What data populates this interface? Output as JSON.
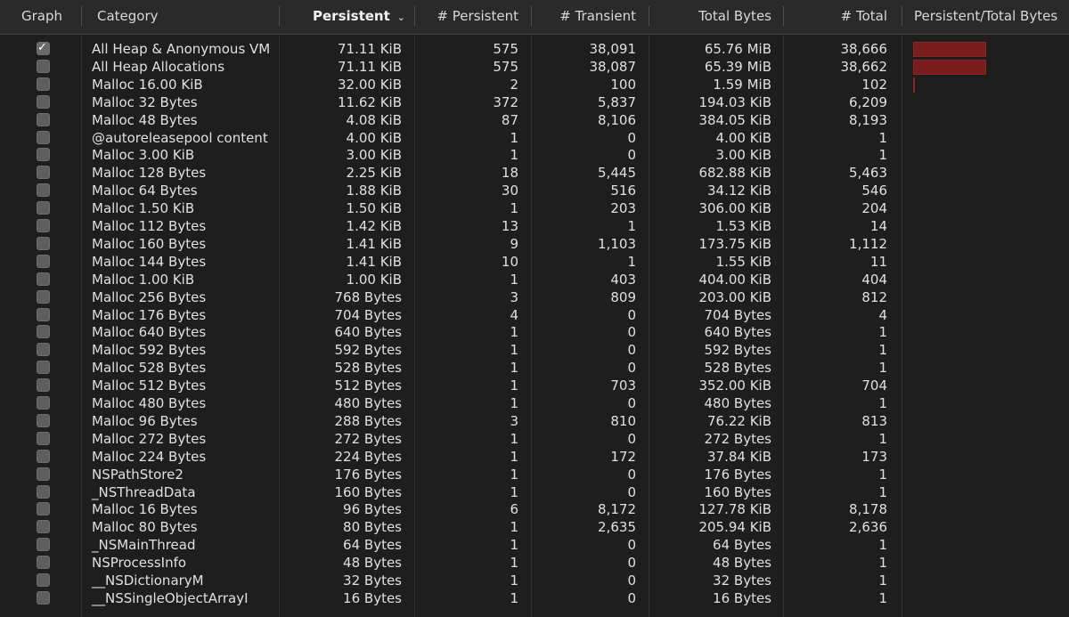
{
  "header": {
    "graph": "Graph",
    "category": "Category",
    "persistent": "Persistent",
    "persistent_count": "# Persistent",
    "transient_count": "# Transient",
    "total_bytes": "Total Bytes",
    "total_count": "# Total",
    "ratio": "Persistent/Total Bytes"
  },
  "sort": {
    "column": "Persistent",
    "direction": "descending",
    "icon": "chevron-down-icon"
  },
  "colors": {
    "ratio_bar": "#7a1d1d"
  },
  "rows": [
    {
      "graph": true,
      "category": "All Heap & Anonymous VM",
      "persistent": "71.11 KiB",
      "persistent_count": "575",
      "transient_count": "38,091",
      "total_bytes": "65.76 MiB",
      "total_count": "38,666",
      "ratio": 1.0
    },
    {
      "graph": false,
      "category": "All Heap Allocations",
      "persistent": "71.11 KiB",
      "persistent_count": "575",
      "transient_count": "38,087",
      "total_bytes": "65.39 MiB",
      "total_count": "38,662",
      "ratio": 1.0
    },
    {
      "graph": false,
      "category": "Malloc 16.00 KiB",
      "persistent": "32.00 KiB",
      "persistent_count": "2",
      "transient_count": "100",
      "total_bytes": "1.59 MiB",
      "total_count": "102",
      "ratio": 0.02
    },
    {
      "graph": false,
      "category": "Malloc 32 Bytes",
      "persistent": "11.62 KiB",
      "persistent_count": "372",
      "transient_count": "5,837",
      "total_bytes": "194.03 KiB",
      "total_count": "6,209",
      "ratio": 0
    },
    {
      "graph": false,
      "category": "Malloc 48 Bytes",
      "persistent": "4.08 KiB",
      "persistent_count": "87",
      "transient_count": "8,106",
      "total_bytes": "384.05 KiB",
      "total_count": "8,193",
      "ratio": 0
    },
    {
      "graph": false,
      "category": "@autoreleasepool content",
      "persistent": "4.00 KiB",
      "persistent_count": "1",
      "transient_count": "0",
      "total_bytes": "4.00 KiB",
      "total_count": "1",
      "ratio": 0
    },
    {
      "graph": false,
      "category": "Malloc 3.00 KiB",
      "persistent": "3.00 KiB",
      "persistent_count": "1",
      "transient_count": "0",
      "total_bytes": "3.00 KiB",
      "total_count": "1",
      "ratio": 0
    },
    {
      "graph": false,
      "category": "Malloc 128 Bytes",
      "persistent": "2.25 KiB",
      "persistent_count": "18",
      "transient_count": "5,445",
      "total_bytes": "682.88 KiB",
      "total_count": "5,463",
      "ratio": 0
    },
    {
      "graph": false,
      "category": "Malloc 64 Bytes",
      "persistent": "1.88 KiB",
      "persistent_count": "30",
      "transient_count": "516",
      "total_bytes": "34.12 KiB",
      "total_count": "546",
      "ratio": 0
    },
    {
      "graph": false,
      "category": "Malloc 1.50 KiB",
      "persistent": "1.50 KiB",
      "persistent_count": "1",
      "transient_count": "203",
      "total_bytes": "306.00 KiB",
      "total_count": "204",
      "ratio": 0
    },
    {
      "graph": false,
      "category": "Malloc 112 Bytes",
      "persistent": "1.42 KiB",
      "persistent_count": "13",
      "transient_count": "1",
      "total_bytes": "1.53 KiB",
      "total_count": "14",
      "ratio": 0
    },
    {
      "graph": false,
      "category": "Malloc 160 Bytes",
      "persistent": "1.41 KiB",
      "persistent_count": "9",
      "transient_count": "1,103",
      "total_bytes": "173.75 KiB",
      "total_count": "1,112",
      "ratio": 0
    },
    {
      "graph": false,
      "category": "Malloc 144 Bytes",
      "persistent": "1.41 KiB",
      "persistent_count": "10",
      "transient_count": "1",
      "total_bytes": "1.55 KiB",
      "total_count": "11",
      "ratio": 0
    },
    {
      "graph": false,
      "category": "Malloc 1.00 KiB",
      "persistent": "1.00 KiB",
      "persistent_count": "1",
      "transient_count": "403",
      "total_bytes": "404.00 KiB",
      "total_count": "404",
      "ratio": 0
    },
    {
      "graph": false,
      "category": "Malloc 256 Bytes",
      "persistent": "768 Bytes",
      "persistent_count": "3",
      "transient_count": "809",
      "total_bytes": "203.00 KiB",
      "total_count": "812",
      "ratio": 0
    },
    {
      "graph": false,
      "category": "Malloc 176 Bytes",
      "persistent": "704 Bytes",
      "persistent_count": "4",
      "transient_count": "0",
      "total_bytes": "704 Bytes",
      "total_count": "4",
      "ratio": 0
    },
    {
      "graph": false,
      "category": "Malloc 640 Bytes",
      "persistent": "640 Bytes",
      "persistent_count": "1",
      "transient_count": "0",
      "total_bytes": "640 Bytes",
      "total_count": "1",
      "ratio": 0
    },
    {
      "graph": false,
      "category": "Malloc 592 Bytes",
      "persistent": "592 Bytes",
      "persistent_count": "1",
      "transient_count": "0",
      "total_bytes": "592 Bytes",
      "total_count": "1",
      "ratio": 0
    },
    {
      "graph": false,
      "category": "Malloc 528 Bytes",
      "persistent": "528 Bytes",
      "persistent_count": "1",
      "transient_count": "0",
      "total_bytes": "528 Bytes",
      "total_count": "1",
      "ratio": 0
    },
    {
      "graph": false,
      "category": "Malloc 512 Bytes",
      "persistent": "512 Bytes",
      "persistent_count": "1",
      "transient_count": "703",
      "total_bytes": "352.00 KiB",
      "total_count": "704",
      "ratio": 0
    },
    {
      "graph": false,
      "category": "Malloc 480 Bytes",
      "persistent": "480 Bytes",
      "persistent_count": "1",
      "transient_count": "0",
      "total_bytes": "480 Bytes",
      "total_count": "1",
      "ratio": 0
    },
    {
      "graph": false,
      "category": "Malloc 96 Bytes",
      "persistent": "288 Bytes",
      "persistent_count": "3",
      "transient_count": "810",
      "total_bytes": "76.22 KiB",
      "total_count": "813",
      "ratio": 0
    },
    {
      "graph": false,
      "category": "Malloc 272 Bytes",
      "persistent": "272 Bytes",
      "persistent_count": "1",
      "transient_count": "0",
      "total_bytes": "272 Bytes",
      "total_count": "1",
      "ratio": 0
    },
    {
      "graph": false,
      "category": "Malloc 224 Bytes",
      "persistent": "224 Bytes",
      "persistent_count": "1",
      "transient_count": "172",
      "total_bytes": "37.84 KiB",
      "total_count": "173",
      "ratio": 0
    },
    {
      "graph": false,
      "category": "NSPathStore2",
      "persistent": "176 Bytes",
      "persistent_count": "1",
      "transient_count": "0",
      "total_bytes": "176 Bytes",
      "total_count": "1",
      "ratio": 0
    },
    {
      "graph": false,
      "category": "_NSThreadData",
      "persistent": "160 Bytes",
      "persistent_count": "1",
      "transient_count": "0",
      "total_bytes": "160 Bytes",
      "total_count": "1",
      "ratio": 0
    },
    {
      "graph": false,
      "category": "Malloc 16 Bytes",
      "persistent": "96 Bytes",
      "persistent_count": "6",
      "transient_count": "8,172",
      "total_bytes": "127.78 KiB",
      "total_count": "8,178",
      "ratio": 0
    },
    {
      "graph": false,
      "category": "Malloc 80 Bytes",
      "persistent": "80 Bytes",
      "persistent_count": "1",
      "transient_count": "2,635",
      "total_bytes": "205.94 KiB",
      "total_count": "2,636",
      "ratio": 0
    },
    {
      "graph": false,
      "category": "_NSMainThread",
      "persistent": "64 Bytes",
      "persistent_count": "1",
      "transient_count": "0",
      "total_bytes": "64 Bytes",
      "total_count": "1",
      "ratio": 0
    },
    {
      "graph": false,
      "category": "NSProcessInfo",
      "persistent": "48 Bytes",
      "persistent_count": "1",
      "transient_count": "0",
      "total_bytes": "48 Bytes",
      "total_count": "1",
      "ratio": 0
    },
    {
      "graph": false,
      "category": "__NSDictionaryM",
      "persistent": "32 Bytes",
      "persistent_count": "1",
      "transient_count": "0",
      "total_bytes": "32 Bytes",
      "total_count": "1",
      "ratio": 0
    },
    {
      "graph": false,
      "category": "__NSSingleObjectArrayI",
      "persistent": "16 Bytes",
      "persistent_count": "1",
      "transient_count": "0",
      "total_bytes": "16 Bytes",
      "total_count": "1",
      "ratio": 0
    }
  ]
}
